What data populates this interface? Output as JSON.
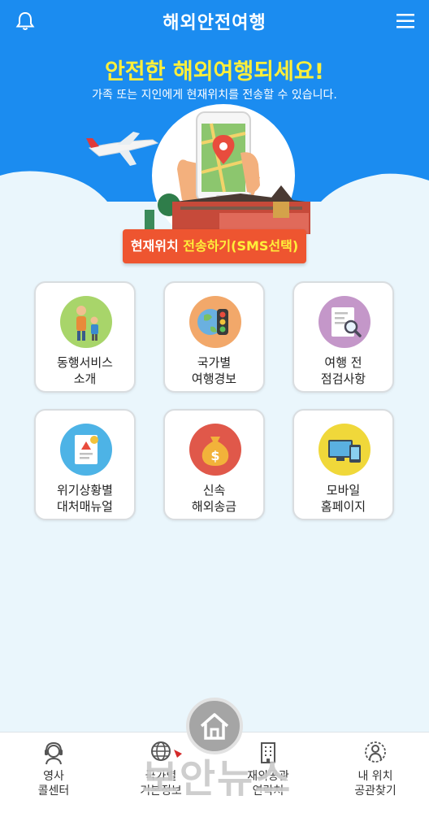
{
  "header": {
    "title": "해외안전여행",
    "bell_icon": "bell-icon",
    "menu_icon": "hamburger-menu-icon"
  },
  "hero": {
    "headline": "안전한 해외여행되세요!",
    "subhead": "가족 또는 지인에게 현재위치를 전송할 수 있습니다.",
    "sms_button": {
      "label_prefix": "현재위치 ",
      "label_accent": "전송하기(SMS선택)"
    }
  },
  "colors": {
    "hero_blue": "#1b8cf0",
    "background": "#eaf6fc",
    "sms_button": "#ee5530",
    "headline_yellow": "#ffef3a"
  },
  "menu_cards": [
    {
      "line1": "동행서비스",
      "line2": "소개",
      "icon": "companion-icon",
      "color": "#a8d56a"
    },
    {
      "line1": "국가별",
      "line2": "여행경보",
      "icon": "globe-traffic-light-icon",
      "color": "#f2a86a"
    },
    {
      "line1": "여행 전",
      "line2": "점검사항",
      "icon": "checklist-magnifier-icon",
      "color": "#c497c9"
    },
    {
      "line1": "위기상황별",
      "line2": "대처매뉴얼",
      "icon": "emergency-manual-icon",
      "color": "#4db3e6"
    },
    {
      "line1": "신속",
      "line2": "해외송금",
      "icon": "money-bag-icon",
      "color": "#e0584a"
    },
    {
      "line1": "모바일",
      "line2": "홈페이지",
      "icon": "mobile-devices-icon",
      "color": "#f0d83a"
    }
  ],
  "bottom_nav": {
    "home_icon": "home-icon",
    "items": [
      {
        "line1": "영사",
        "line2": "콜센터",
        "icon": "headset-agent-icon"
      },
      {
        "line1": "국가별",
        "line2": "기본정보",
        "icon": "globe-icon"
      },
      {
        "line1": "재외공관",
        "line2": "연락처",
        "icon": "building-icon"
      },
      {
        "line1": "내 위치",
        "line2": "공관찾기",
        "icon": "location-person-icon"
      }
    ]
  },
  "watermark": {
    "text": "보안뉴스"
  }
}
